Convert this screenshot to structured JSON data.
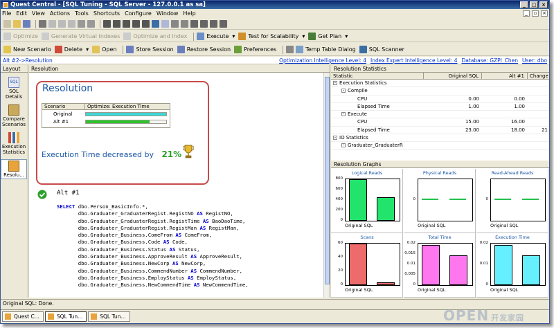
{
  "window": {
    "title": "Quest Central - [SQL Tuning - SQL Server - 127.0.0.1 as sa]"
  },
  "menu": [
    "File",
    "Edit",
    "View",
    "Actions",
    "Tools",
    "Shortcuts",
    "Configure",
    "Window",
    "Help"
  ],
  "toolbar2": {
    "optimize": "Optimize",
    "generate_indexes": "Generate Virtual Indexes",
    "optimize_index": "Optimize and Index",
    "execute": "Execute",
    "test_scalability": "Test for Scalability",
    "get_plan": "Get Plan"
  },
  "toolbar3": {
    "new_scenario": "New Scenario",
    "delete": "Delete",
    "open": "Open",
    "store_session": "Store Session",
    "restore_session": "Restore Session",
    "preferences": "Preferences",
    "temp_table": "Temp Table Dialog",
    "sql_scanner": "SQL Scanner"
  },
  "infobar": {
    "breadcrumb": "Alt #2->Resolution",
    "opt_level": "Optimization Intelligence Level: 4",
    "index_level": "Index Expert Intelligence Level: 4",
    "database": "Database: GZPI_Chen",
    "user": "User: dbo"
  },
  "left": {
    "tab": "Layout",
    "items": [
      {
        "label": "SQL Details"
      },
      {
        "label": "Compare Scenarios"
      },
      {
        "label": "Execution Statistics"
      },
      {
        "label": "Resolu..."
      }
    ]
  },
  "resolution": {
    "tab": "Resolution",
    "title": "Resolution",
    "table_headers": {
      "scenario": "Scenario",
      "optimize": "Optimize: Execution Time"
    },
    "scenarios": [
      {
        "name": "Original",
        "fill": 1.0,
        "color": "#3fd6d6"
      },
      {
        "name": "Alt #1",
        "fill": 0.79,
        "color": "#2ec22e"
      }
    ],
    "decrease_text": "Execution Time decreased by",
    "decrease_pct": "21%",
    "alt_label": "Alt #1",
    "sql_lines": [
      [
        {
          "kw": "SELECT"
        },
        {
          "t": " dbo.Person_BasicInfo.*,"
        }
      ],
      [
        {
          "t": "       dbo.Graduater_GraduaterRegist.RegistNO "
        },
        {
          "kw": "AS"
        },
        {
          "t": " RegistNO,"
        }
      ],
      [
        {
          "t": "       dbo.Graduater_GraduaterRegist.RegistTime "
        },
        {
          "kw": "AS"
        },
        {
          "t": " BaoDaoTime,"
        }
      ],
      [
        {
          "t": "       dbo.Graduater_GraduaterRegist.RegistMan "
        },
        {
          "kw": "AS"
        },
        {
          "t": " RegistMan,"
        }
      ],
      [
        {
          "t": "       dbo.Graduater_Business.ComeFrom "
        },
        {
          "kw": "AS"
        },
        {
          "t": " ComeFrom,"
        }
      ],
      [
        {
          "t": "       dbo.Graduater_Business.Code "
        },
        {
          "kw": "AS"
        },
        {
          "t": " Code,"
        }
      ],
      [
        {
          "t": "       dbo.Graduater_Business.Status "
        },
        {
          "kw": "AS"
        },
        {
          "t": " Status,"
        }
      ],
      [
        {
          "t": "       dbo.Graduater_Business.ApproveResult "
        },
        {
          "kw": "AS"
        },
        {
          "t": " ApproveResult,"
        }
      ],
      [
        {
          "t": "       dbo.Graduater_Business.NewCorp "
        },
        {
          "kw": "AS"
        },
        {
          "t": " NewCorp,"
        }
      ],
      [
        {
          "t": "       dbo.Graduater_Business.CommendNumber "
        },
        {
          "kw": "AS"
        },
        {
          "t": " CommendNumber,"
        }
      ],
      [
        {
          "t": "       dbo.Graduater_Business.EmployStatus "
        },
        {
          "kw": "AS"
        },
        {
          "t": " EmployStatus,"
        }
      ],
      [
        {
          "t": "       dbo.Graduater_Business.NewCommendTime "
        },
        {
          "kw": "AS"
        },
        {
          "t": " NewCommendTime,"
        }
      ]
    ]
  },
  "statistics": {
    "tab": "Resolution Statistics",
    "headers": [
      "Statistic",
      "Original SQL",
      "Alt #1",
      "Change"
    ],
    "rows": [
      {
        "name": "Execution Statistics",
        "indent": 0,
        "tree": "-",
        "orig": "",
        "alt": "",
        "change": ""
      },
      {
        "name": "Compile",
        "indent": 1,
        "tree": "-",
        "orig": "",
        "alt": "",
        "change": ""
      },
      {
        "name": "CPU",
        "indent": 2,
        "tree": "",
        "orig": "0.00",
        "alt": "0.00",
        "change": ""
      },
      {
        "name": "Elapsed Time",
        "indent": 2,
        "tree": "",
        "orig": "1.00",
        "alt": "1.00",
        "change": ""
      },
      {
        "name": "Execute",
        "indent": 1,
        "tree": "-",
        "orig": "",
        "alt": "",
        "change": ""
      },
      {
        "name": "CPU",
        "indent": 2,
        "tree": "",
        "orig": "15.00",
        "alt": "16.00",
        "change": ""
      },
      {
        "name": "Elapsed Time",
        "indent": 2,
        "tree": "",
        "orig": "23.00",
        "alt": "18.00",
        "change": "21"
      },
      {
        "name": "IO Statistics",
        "indent": 0,
        "tree": "-",
        "orig": "",
        "alt": "",
        "change": ""
      },
      {
        "name": "Graduater_GraduaterR",
        "indent": 1,
        "tree": "-",
        "orig": "",
        "alt": "",
        "change": ""
      }
    ]
  },
  "graphs": {
    "tab": "Resolution Graphs",
    "xlabel": "Original SQL",
    "cells": [
      {
        "title": "Logical Reads",
        "ticks": [
          "800",
          "600",
          "400",
          "200",
          "0"
        ],
        "ymax": 800,
        "values": [
          805,
          450
        ],
        "colors": [
          "#22e36b",
          "#22e36b"
        ]
      },
      {
        "title": "Physical Reads",
        "ticks": [
          "0"
        ],
        "ymax": 1,
        "values": [
          0,
          0
        ],
        "colors": [
          "#22c04b",
          "#22c04b"
        ]
      },
      {
        "title": "Read-Ahead Reads",
        "ticks": [
          "0"
        ],
        "ymax": 1,
        "values": [
          0,
          0
        ],
        "colors": [
          "#22c04b",
          "#22c04b"
        ]
      },
      {
        "title": "Scans",
        "ticks": [
          "60",
          "40",
          "20",
          "0"
        ],
        "ymax": 70,
        "values": [
          70,
          5
        ],
        "colors": [
          "#ee6b6b",
          "#ee6b6b"
        ]
      },
      {
        "title": "Total Time",
        "ticks": [
          "0.02",
          "0.015",
          "0.01",
          "0.005",
          "0"
        ],
        "ymax": 0.025,
        "values": [
          0.024,
          0.018
        ],
        "colors": [
          "#ff77ee",
          "#ff77ee"
        ]
      },
      {
        "title": "Execution Time",
        "ticks": [
          "0.02",
          "0.01",
          "0"
        ],
        "ymax": 0.025,
        "values": [
          0.024,
          0.018
        ],
        "colors": [
          "#66f0ff",
          "#66f0ff"
        ]
      }
    ]
  },
  "status": "Original SQL: Done.",
  "taskbar": [
    "Quest C...",
    "SQL Tun...",
    "SQL Tun..."
  ],
  "watermark": {
    "big": "OPEN",
    "small": "开发家园"
  }
}
